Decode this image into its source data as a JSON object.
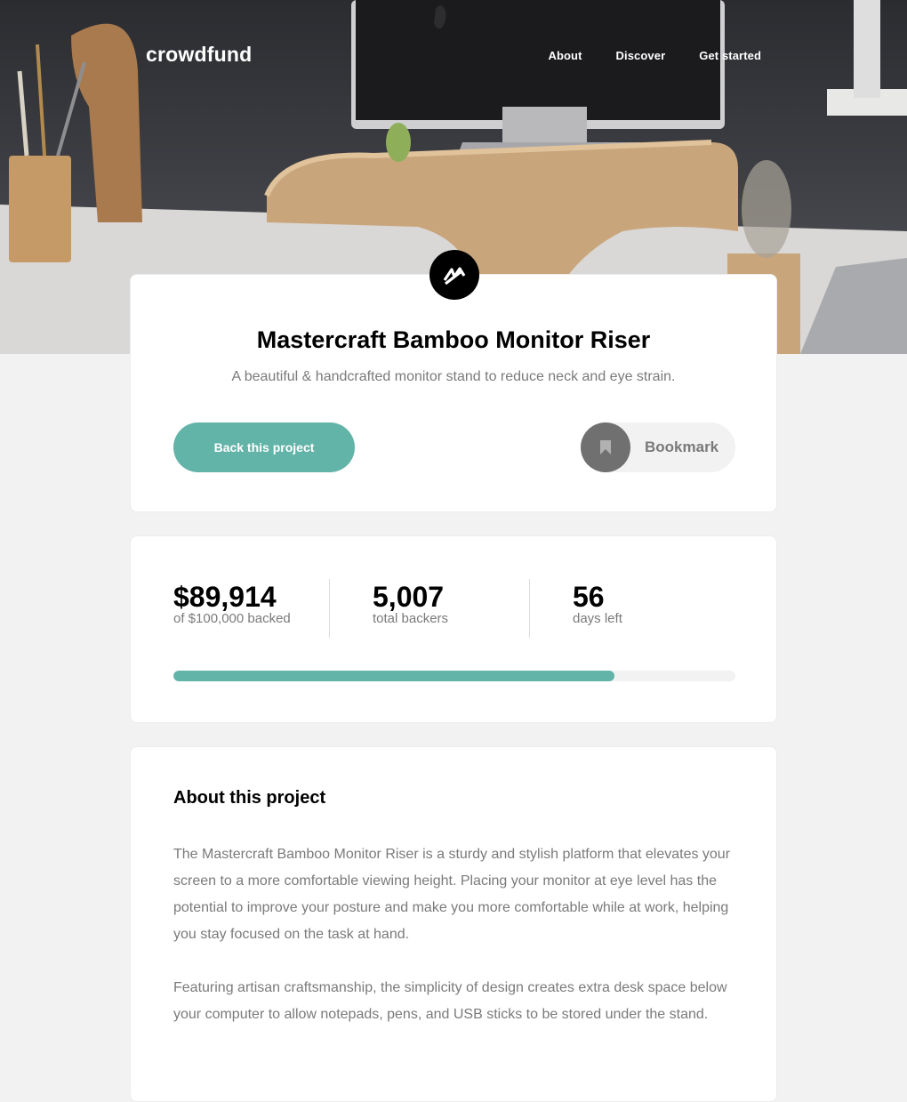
{
  "header": {
    "logo": "crowdfund",
    "nav": [
      "About",
      "Discover",
      "Get started"
    ]
  },
  "project": {
    "brand_icon": "mastercraft-logo-icon",
    "title": "Mastercraft Bamboo Monitor Riser",
    "subtitle": "A beautiful & handcrafted monitor stand to reduce neck and eye strain.",
    "back_label": "Back this project",
    "bookmark_label": "Bookmark"
  },
  "stats": {
    "backed": {
      "value": "$89,914",
      "label": "of $100,000 backed"
    },
    "backers": {
      "value": "5,007",
      "label": "total backers"
    },
    "days": {
      "value": "56",
      "label": "days left"
    },
    "progress_fraction": 0.785
  },
  "about": {
    "title": "About this project",
    "paragraphs": [
      "The Mastercraft Bamboo Monitor Riser is a sturdy and stylish platform that elevates your screen to a more comfortable viewing height. Placing your monitor at eye level has the potential to improve your posture and make you more comfortable while at work, helping you stay focused on the task at hand.",
      "Featuring artisan craftsmanship, the simplicity of design creates extra desk space below your computer to allow notepads, pens, and USB sticks to be stored under the stand."
    ]
  },
  "colors": {
    "accent": "#62b3a8",
    "background": "#f2f2f2",
    "muted_text": "#7a7a7a"
  }
}
